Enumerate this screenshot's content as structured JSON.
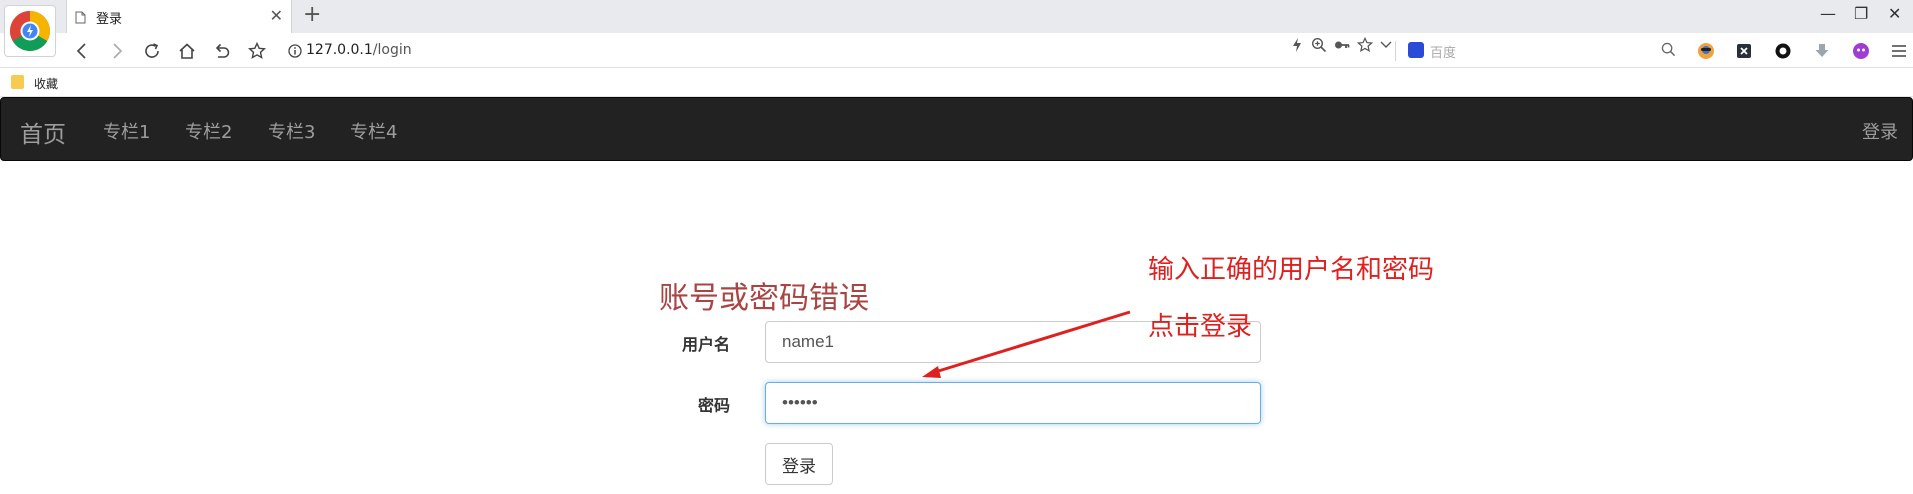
{
  "browser": {
    "tab_title": "登录",
    "url_host": "127.0.0.1",
    "url_path": "/login",
    "search_placeholder": "百度",
    "bookmark_label": "收藏"
  },
  "navbar": {
    "brand": "首页",
    "links": [
      "专栏1",
      "专栏2",
      "专栏3",
      "专栏4"
    ],
    "login": "登录"
  },
  "form": {
    "error": "账号或密码错误",
    "username_label": "用户名",
    "username_value": "name1",
    "password_label": "密码",
    "password_value": "••••••",
    "submit_label": "登录"
  },
  "annotation": {
    "line1": "输入正确的用户名和密码",
    "line2": "点击登录",
    "color": "#e0201e"
  }
}
